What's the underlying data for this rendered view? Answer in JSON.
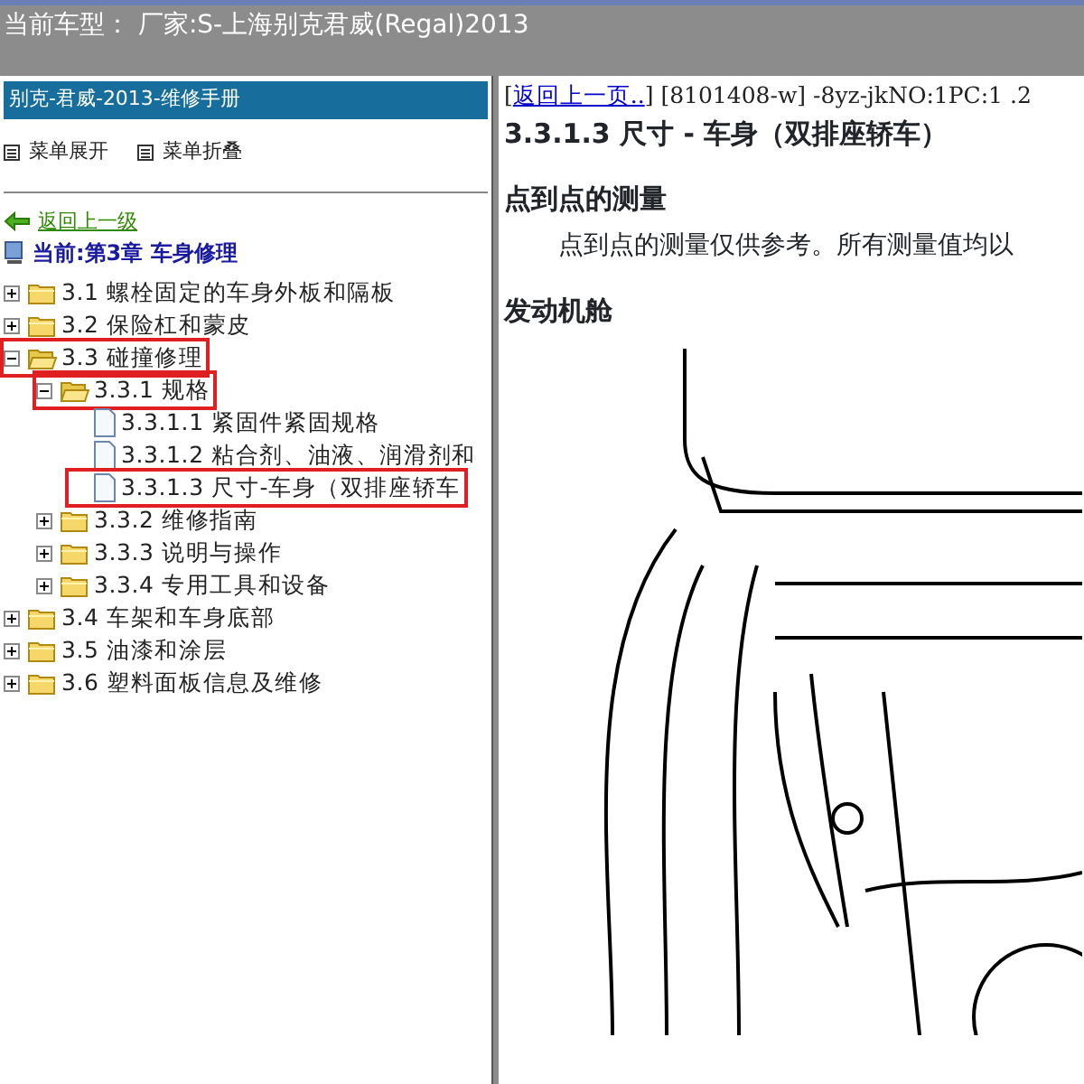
{
  "header": {
    "title": "当前车型： 厂家:S-上海别克君威(Regal)2013"
  },
  "sidebar": {
    "title": "别克-君威-2013-维修手册",
    "buttons": [
      "菜单展开",
      "菜单折叠"
    ],
    "back_link": "返回上一级",
    "current": "当前:第3章 车身修理",
    "tree": [
      {
        "label": "3.1 螺栓固定的车身外板和隔板",
        "kind": "folder",
        "expanded": false,
        "marked": false
      },
      {
        "label": "3.2 保险杠和蒙皮",
        "kind": "folder",
        "expanded": false,
        "marked": false
      },
      {
        "label": "3.3 碰撞修理",
        "kind": "folder",
        "expanded": true,
        "marked": true,
        "children": [
          {
            "label": "3.3.1 规格",
            "kind": "folder",
            "expanded": true,
            "marked": true,
            "children": [
              {
                "label": "3.3.1.1 紧固件紧固规格",
                "kind": "page",
                "marked": false
              },
              {
                "label": "3.3.1.2 粘合剂、油液、润滑剂和",
                "kind": "page",
                "marked": false
              },
              {
                "label": "3.3.1.3 尺寸-车身（双排座轿车",
                "kind": "page",
                "marked": true
              }
            ]
          },
          {
            "label": "3.3.2 维修指南",
            "kind": "folder",
            "expanded": false,
            "marked": false
          },
          {
            "label": "3.3.3 说明与操作",
            "kind": "folder",
            "expanded": false,
            "marked": false
          },
          {
            "label": "3.3.4 专用工具和设备",
            "kind": "folder",
            "expanded": false,
            "marked": false
          }
        ]
      },
      {
        "label": "3.4 车架和车身底部",
        "kind": "folder",
        "expanded": false,
        "marked": false
      },
      {
        "label": "3.5 油漆和涂层",
        "kind": "folder",
        "expanded": false,
        "marked": false
      },
      {
        "label": "3.6 塑料面板信息及维修",
        "kind": "folder",
        "expanded": false,
        "marked": false
      }
    ]
  },
  "content": {
    "back_prefix": "[",
    "back_link": "返回上一页..",
    "back_suffix": "] [8101408-w] -8yz-jkNO:1PC:1 .2",
    "title": "3.3.1.3 尺寸 - 车身（双排座轿车）",
    "sections": [
      {
        "heading": "点到点的测量",
        "text": "点到点的测量仅供参考。所有测量值均以"
      },
      {
        "heading": "发动机舱"
      }
    ]
  }
}
